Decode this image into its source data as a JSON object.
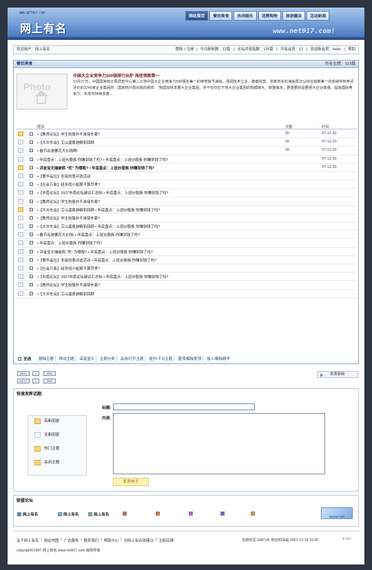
{
  "header": {
    "url_small": "WWW.NET917.COM",
    "logo": "网上有名",
    "big_url": "www.net917.com!",
    "nav": [
      "网站首页",
      "餐饮美食",
      "休闲娱乐",
      "消费购物",
      "旅游摄店",
      "活动新闻"
    ]
  },
  "userbar": {
    "welcome": "欢迎用户：网上有名",
    "login": "登陆",
    "sep": "|",
    "register": "注册",
    "stats": [
      "今日新帖数：12篇",
      "论坛共有贴数：125篇",
      "共有会员：12",
      "欢迎新会员：hebe"
    ],
    "help": "帮助"
  },
  "board": {
    "title": "餐饮美食",
    "topic_count": "共有主题：123篇",
    "photo_placeholder": "Photo",
    "featured_title": "中国大企业竞争力500强排行出炉 海信领跑第一",
    "featured_desc": "10月27日，中国国家统计局调查中心第二次将中国大企业竞争力500强名第一的荣誉授予海信。强调技术立业、稳健经营、求真务实的海信再次以综合指数第一的成绩受到参评评价的2245家企业集团的…国家统计局论报的那样：“我国加快发展大企业集团，并不仅仅在于将大企业集团的规模做大、数量做多，更重要的是要把大企业做强，提高国际竞争力，实现可持续发展…",
    "col_topic": "题目",
    "col_replies": "次数",
    "col_time": "时间",
    "rows": [
      {
        "icon": "hot",
        "title": "•【教师论坛】学生狡股外不准穿外套?",
        "bold": false,
        "replies": "30",
        "time": "07-12-20"
      },
      {
        "icon": "new",
        "title": "•【大众车会】艾山温泉游精彩回顾",
        "bold": false,
        "replies": "30",
        "time": "07-12-20"
      },
      {
        "icon": "new",
        "title": "• 春节出游要花大价钱啊!",
        "bold": false,
        "replies": "30",
        "time": "07-12-20"
      },
      {
        "icon": "new",
        "title": "• 年底盘点：上班炒股族 你赚到钱了吗? • 年底盘点：上班炒股族 你赚到钱了吗?",
        "bold": false,
        "replies": "",
        "time": "07-12-20"
      },
      {
        "icon": "hot",
        "title": "• 洪金宝无端被疯 “死” 为哪般? • 年底盘点：上班炒股族 你赚到钱了吗?",
        "bold": true,
        "replies": "",
        "time": "07-12-20"
      },
      {
        "icon": "new",
        "title": "•【奢华品位】圣诞创意评选活动",
        "bold": false,
        "replies": "",
        "time": ""
      },
      {
        "icon": "new",
        "title": "•【社会万象】给多找小姐算不算尽孝?",
        "bold": false,
        "replies": "",
        "time": ""
      },
      {
        "icon": "new",
        "title": "•【市南论坛】2007市南论坛建议汇总帖 • 年底盘点：上班炒股族 你赚到钱了吗?",
        "bold": false,
        "replies": "",
        "time": ""
      },
      {
        "icon": "new",
        "title": "•【教师论坛】学生狡股外不准穿外套?",
        "bold": false,
        "replies": "",
        "time": ""
      },
      {
        "icon": "hot",
        "title": "•【大众车会】艾山温泉游精彩回顾 • 年底盘点：上班炒股族 你赚到钱了吗?",
        "bold": false,
        "replies": "",
        "time": ""
      },
      {
        "icon": "new",
        "title": "•【教师论坛】学生狡股外不准穿外套?",
        "bold": false,
        "replies": "",
        "time": ""
      },
      {
        "icon": "new",
        "title": "•【大众车会】艾山温泉游精彩回顾 • 年底盘点：上班炒股族 你赚到钱了吗?",
        "bold": false,
        "replies": "",
        "time": ""
      },
      {
        "icon": "new",
        "title": "• 春节出游要花大价钱! • 年底盘点：上班炒股族 你赚到钱了吗?",
        "bold": false,
        "replies": "",
        "time": ""
      },
      {
        "icon": "new",
        "title": "• 年底盘点：上班炒股族 你赚到钱了吗?",
        "bold": false,
        "replies": "",
        "time": ""
      },
      {
        "icon": "new",
        "title": "• 洪金宝无端被疯 “死” 为哪般? • 年底盘点：上班炒股族 你赚到钱了吗?",
        "bold": false,
        "replies": "",
        "time": ""
      },
      {
        "icon": "new",
        "title": "•【奢华品位】圣诞创意评选活动 • 年底盘点：上班炒股族 你赚到钱了吗?",
        "bold": false,
        "replies": "",
        "time": ""
      },
      {
        "icon": "new",
        "title": "•【社会万象】给多找小姐算不算尽孝?",
        "bold": false,
        "replies": "",
        "time": ""
      },
      {
        "icon": "new",
        "title": "•【市南论坛】2007市南论坛建议汇总帖 • 年底盘点：上班炒股族 你赚到钱了吗?",
        "bold": false,
        "replies": "",
        "time": ""
      },
      {
        "icon": "new",
        "title": "•【教师论坛】学生狡股外不准穿外套?",
        "bold": false,
        "replies": "",
        "time": ""
      },
      {
        "icon": "new",
        "title": "•【大众车会】艾山温泉游精彩回顾",
        "bold": false,
        "replies": "",
        "time": ""
      }
    ],
    "select_all": "全选",
    "ops": [
      "删除主题",
      "移动主题",
      "高亮显示",
      "主题分类",
      "关闭/打开主题",
      "提升/下沉主题",
      "置顶/解除置顶",
      "加入/解除精华"
    ]
  },
  "pager": {
    "next": "NEXT",
    "prev": "PRE"
  },
  "new_post_button": "发表新帖",
  "quick_post": {
    "title": "快速发新话题:",
    "legend": [
      "有新回复",
      "无新回复",
      "热门主题",
      "关闭主题"
    ],
    "subject_label": "标题:",
    "content_label": "内容:",
    "submit": "发表帖子"
  },
  "links": {
    "title": "联盟论坛",
    "items": [
      "网上有名",
      "网上有名",
      "网上有名"
    ],
    "badge": "Discuz!.net"
  },
  "footer": {
    "links": [
      "关于网上有名",
      "网站地图",
      "广告服务",
      "联系我们",
      "帮助中心",
      "对网上有名提建议",
      "注册店铺"
    ],
    "sep": "|",
    "copyright": "copyright©2007 网上有名 www.net917.com 版权所有",
    "time": "当前时区 GMT+8, 现在时间是 2007-12-19 10:30",
    "top": "top"
  }
}
